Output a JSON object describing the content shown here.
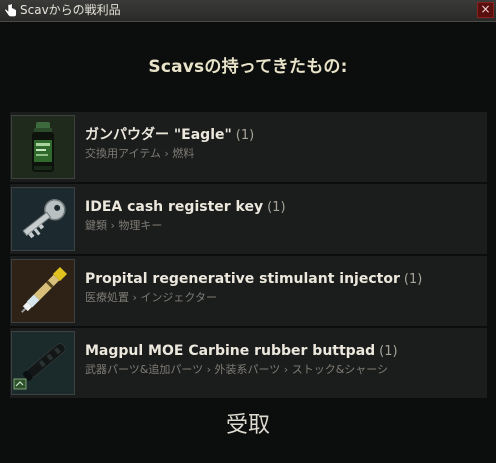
{
  "window": {
    "title": "Scavからの戦利品",
    "close_label": "×"
  },
  "heading": "Scavsの持ってきたもの:",
  "items": [
    {
      "name": "ガンパウダー \"Eagle\"",
      "count": "(1)",
      "category": "交換用アイテム › 燃料",
      "icon": "gunpowder-can-icon"
    },
    {
      "name": "IDEA cash register key",
      "count": "(1)",
      "category": "鍵類 › 物理キー",
      "icon": "key-icon"
    },
    {
      "name": "Propital regenerative stimulant injector",
      "count": "(1)",
      "category": "医療処置 › インジェクター",
      "icon": "injector-icon"
    },
    {
      "name": "Magpul MOE Carbine rubber buttpad",
      "count": "(1)",
      "category": "武器パーツ&追加パーツ › 外装系パーツ › ストック&シャーシ",
      "icon": "buttpad-icon"
    }
  ],
  "receive_label": "受取",
  "colors": {
    "item_bg": "#1b1c1c",
    "thumb_green": "#1f2a1d",
    "thumb_blue": "#1c2a30",
    "thumb_orange": "#2e2116",
    "thumb_teal": "#1b2a2b"
  }
}
